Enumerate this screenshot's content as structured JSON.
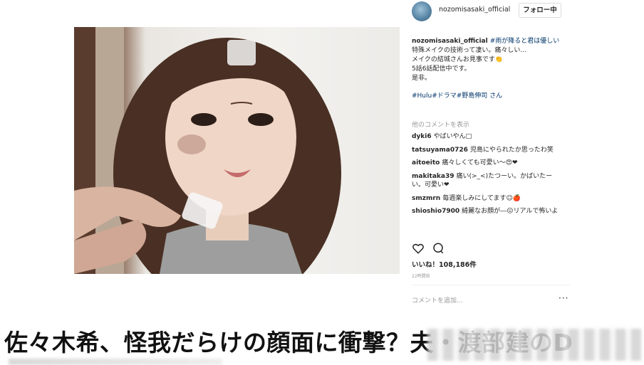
{
  "post": {
    "username": "nozomisasaki_official",
    "follow_label": "フォロー中",
    "caption_user": "nozomisasaki_official",
    "caption_hashtag_title": "#雨が降ると君は優しい",
    "caption_lines": [
      "特殊メイクの技術って凄い。痛々しい…",
      "メイクの結城さんお見事です👏",
      "5話6話配信中です。",
      "是非。"
    ],
    "caption_tags": "#Hulu#ドラマ#野島伸司 さん",
    "view_more": "他のコメントを表示",
    "comments": [
      {
        "user": "dyki6",
        "text": "やばいやん□"
      },
      {
        "user": "tatsuyama0726",
        "text": "児島にやられたか思ったわ笑"
      },
      {
        "user": "aitoeito",
        "text": "痛々しくても可愛い〜😍❤"
      },
      {
        "user": "makitaka39",
        "text": "痛い(>_<)たつーい。かばいたーい。可愛い❤"
      },
      {
        "user": "smzmrn",
        "text": "毎週楽しみにしてます☺🍎"
      },
      {
        "user": "shioshio7900",
        "text": "綺麗なお顔が―😖リアルで怖いよ"
      }
    ],
    "likes": "いいね！108,186件",
    "time": "22時間前",
    "add_comment_placeholder": "コメントを追加...",
    "more_label": "···"
  },
  "headline": "佐々木希、怪我だらけの顔面に衝撃？夫・渡部建のD",
  "icons": {
    "like": "heart-icon",
    "comment": "comment-icon",
    "avatar": "avatar-icon"
  }
}
